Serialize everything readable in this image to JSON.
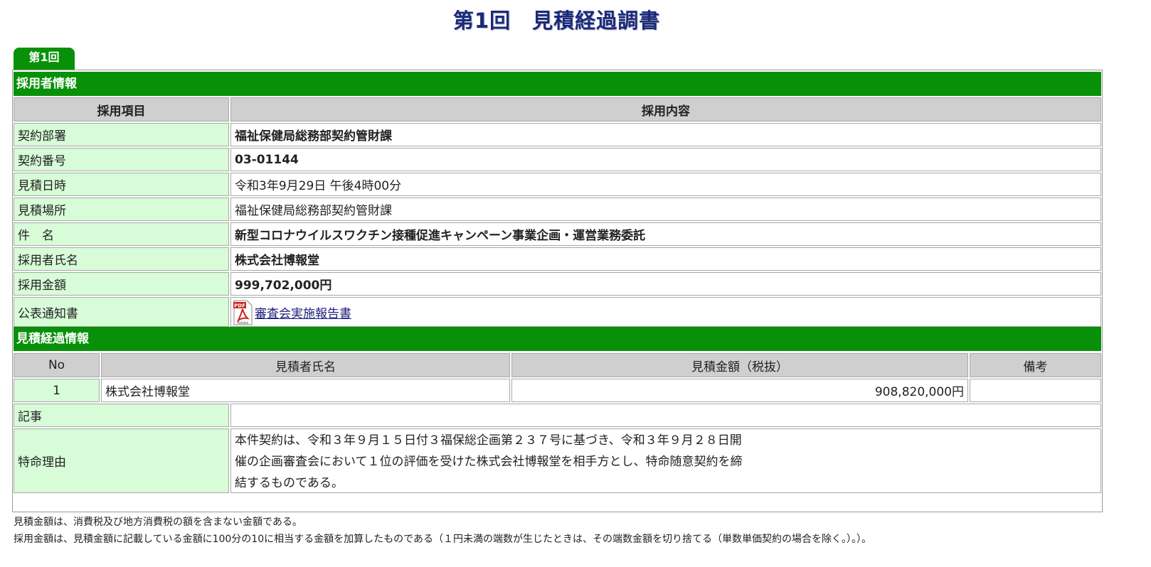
{
  "page_title": "第1回　見積経過調書",
  "tab_label": "第1回",
  "adoption": {
    "section_title": "採用者情報",
    "header_item": "採用項目",
    "header_content": "採用内容",
    "rows": [
      {
        "label": "契約部署",
        "value": "福祉保健局総務部契約管財課"
      },
      {
        "label": "契約番号",
        "value": "03-01144"
      },
      {
        "label": "見積日時",
        "value": "令和3年9月29日 午後4時00分"
      },
      {
        "label": "見積場所",
        "value": "福祉保健局総務部契約管財課"
      },
      {
        "label": "件　名",
        "value": "新型コロナウイルスワクチン接種促進キャンペーン事業企画・運営業務委託"
      },
      {
        "label": "採用者氏名",
        "value": "株式会社博報堂"
      },
      {
        "label": "採用金額",
        "value": "999,702,000円"
      },
      {
        "label": "公表通知書",
        "value": "審査会実施報告書"
      }
    ],
    "pdf_icon_text": "PDF",
    "pdf_icon_subtext": "Adobe"
  },
  "estimates": {
    "section_title": "見積経過情報",
    "headers": [
      "No",
      "見積者氏名",
      "見積金額（税抜）",
      "備考"
    ],
    "rows": [
      {
        "no": "1",
        "name": "株式会社博報堂",
        "amount": "908,820,000円",
        "remarks": ""
      }
    ],
    "article_label": "記事",
    "article_value": "",
    "reason_label": "特命理由",
    "reason_lines": [
      "本件契約は、令和３年９月１５日付３福保総企画第２３７号に基づき、令和３年９月２８日開",
      "催の企画審査会において１位の評価を受けた株式会社博報堂を相手方とし、特命随意契約を締",
      "結するものである。"
    ]
  },
  "notes": [
    "見積金額は、消費税及び地方消費税の額を含まない金額である。",
    "採用金額は、見積金額に記載している金額に100分の10に相当する金額を加算したものである（１円未満の端数が生じたときは、その端数金額を切り捨てる（単数単価契約の場合を除く。）。）。"
  ],
  "colors": {
    "green": "#089108",
    "label_bg": "#d7fcd7",
    "header_bg": "#cfcfcf",
    "title": "#1a2a7a"
  }
}
